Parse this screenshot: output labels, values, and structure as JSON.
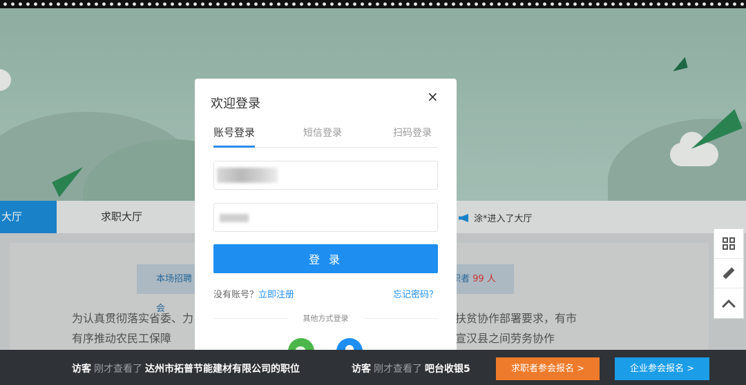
{
  "nav": {
    "tab_active": "大厅",
    "tab_jobseek": "求职大厅",
    "notice": "涂*进入了大厅"
  },
  "stats": {
    "left_label": "本场招聘会",
    "right_label": "职者",
    "right_count": "99",
    "right_unit": "人"
  },
  "content": {
    "left_text": "为认真贯彻落实省委、力有序推动农民工保障",
    "right_text": "扶贫协作部署要求，有市宣汉县之间劳务协作"
  },
  "modal": {
    "title": "欢迎登录",
    "close": "×",
    "tabs": [
      "账号登录",
      "短信登录",
      "扫码登录"
    ],
    "login_button": "登 录",
    "no_account": "没有账号？",
    "register": "立即注册",
    "forgot": "忘记密码？",
    "other_methods": "其他方式登录"
  },
  "ticker": [
    {
      "visitor": "访客",
      "action": "刚才查看了",
      "target": "达州市拓普节能建材有限公司的职位"
    },
    {
      "visitor": "访客",
      "action": "刚才查看了",
      "target": "吧台收银5"
    }
  ],
  "buttons": {
    "seeker_signup": "求职者参会报名 >",
    "company_signup": "企业参会报名 >"
  },
  "colors": {
    "primary": "#1e8ff0",
    "orange": "#ee7b2b",
    "banner": "#9fbfb2"
  }
}
